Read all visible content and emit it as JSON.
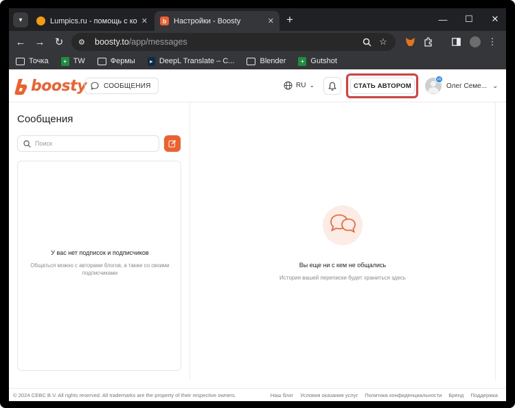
{
  "browser": {
    "tabs": [
      {
        "title": "Lumpics.ru - помощь с компь",
        "active": false
      },
      {
        "title": "Настройки - Boosty",
        "active": true
      }
    ],
    "url_host": "boosty.to",
    "url_path": "/app/messages",
    "bookmarks": [
      {
        "label": "Точка",
        "icon": "folder-icon"
      },
      {
        "label": "TW",
        "icon": "sheets-icon"
      },
      {
        "label": "Фермы",
        "icon": "folder-icon"
      },
      {
        "label": "DeepL Translate – C...",
        "icon": "deepl-icon"
      },
      {
        "label": "Blender",
        "icon": "folder-icon"
      },
      {
        "label": "Gutshot",
        "icon": "sheets-icon"
      }
    ]
  },
  "header": {
    "logo_text": "boosty",
    "messages_button": "СООБЩЕНИЯ",
    "language": "RU",
    "become_author_button": "СТАТЬ АВТОРОМ",
    "user_name": "Олег Семе..."
  },
  "sidebar": {
    "title": "Сообщения",
    "search_placeholder": "Поиск",
    "empty_title": "У вас нет подписок и подписчиков",
    "empty_subtitle": "Общаться можно с авторами блогов, а также со своими подписчиками"
  },
  "chat": {
    "empty_title": "Вы еще ни с кем не общались",
    "empty_subtitle": "История вашей переписки будет храниться здесь"
  },
  "footer": {
    "copyright": "© 2024 CEBC B.V. All rights reserved. All trademarks are the property of their respective owners.",
    "links": [
      "Наш блог",
      "Условия оказания услуг",
      "Политика конфиденциальности",
      "Бренд",
      "Поддержка"
    ]
  },
  "colors": {
    "accent": "#f15f2c",
    "highlight": "#e53935"
  }
}
